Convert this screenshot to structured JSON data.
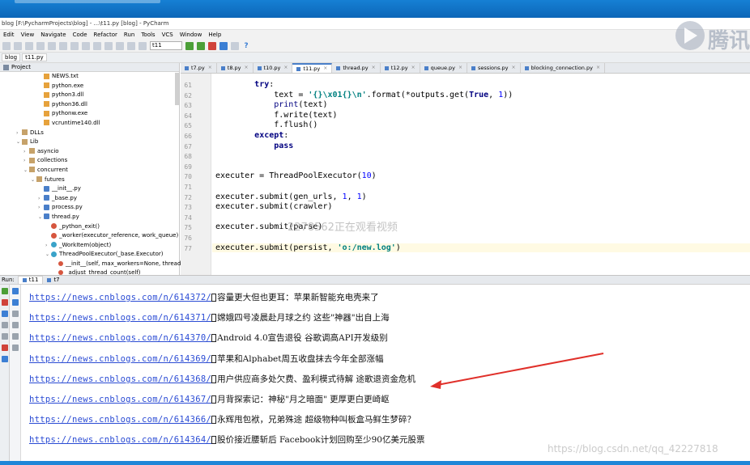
{
  "window": {
    "title": "blog [F:\\PycharmProjects\\blog] - ...\\t11.py [blog] - PyCharm"
  },
  "menu": [
    "Edit",
    "View",
    "Navigate",
    "Code",
    "Refactor",
    "Run",
    "Tools",
    "VCS",
    "Window",
    "Help"
  ],
  "toolbar": {
    "run_config": "t11",
    "help": "?"
  },
  "breadcrumb": [
    "blog",
    "t11.py"
  ],
  "logo_text": "腾讯",
  "project_panel": {
    "header": "Project",
    "tree": [
      {
        "label": "NEWS.txt",
        "icon": "file-icon",
        "depth": 5
      },
      {
        "label": "python.exe",
        "icon": "file-icon",
        "depth": 5
      },
      {
        "label": "python3.dll",
        "icon": "file-icon",
        "depth": 5
      },
      {
        "label": "python36.dll",
        "icon": "file-icon",
        "depth": 5
      },
      {
        "label": "pythonw.exe",
        "icon": "file-icon",
        "depth": 5
      },
      {
        "label": "vcruntime140.dll",
        "icon": "file-icon",
        "depth": 5
      },
      {
        "label": "DLLs",
        "icon": "folder-icon",
        "depth": 2,
        "arrow": "›"
      },
      {
        "label": "Lib",
        "icon": "folder-icon",
        "depth": 2,
        "arrow": "⌄"
      },
      {
        "label": "asyncio",
        "icon": "folder-icon",
        "depth": 3,
        "arrow": "›"
      },
      {
        "label": "collections",
        "icon": "folder-icon",
        "depth": 3,
        "arrow": "›"
      },
      {
        "label": "concurrent",
        "icon": "folder-icon",
        "depth": 3,
        "arrow": "⌄"
      },
      {
        "label": "futures",
        "icon": "folder-icon",
        "depth": 4,
        "arrow": "⌄"
      },
      {
        "label": "__init__.py",
        "icon": "python-file-icon",
        "depth": 5
      },
      {
        "label": "_base.py",
        "icon": "python-file-icon",
        "depth": 5,
        "arrow": "›"
      },
      {
        "label": "process.py",
        "icon": "python-file-icon",
        "depth": 5,
        "arrow": "›"
      },
      {
        "label": "thread.py",
        "icon": "python-file-icon",
        "depth": 5,
        "arrow": "⌄"
      },
      {
        "label": "_python_exit()",
        "icon": "function-icon",
        "depth": 6
      },
      {
        "label": "_worker(executor_reference, work_queue)",
        "icon": "function-icon",
        "depth": 6
      },
      {
        "label": "_WorkItem(object)",
        "icon": "class-icon",
        "depth": 6,
        "arrow": "›"
      },
      {
        "label": "ThreadPoolExecutor(_base.Executor)",
        "icon": "class-icon",
        "depth": 6,
        "arrow": "⌄"
      },
      {
        "label": "__init__(self, max_workers=None, thread",
        "icon": "method-icon",
        "depth": 7
      },
      {
        "label": "_adjust_thread_count(self)",
        "icon": "method-icon",
        "depth": 7
      }
    ]
  },
  "editor_tabs": [
    {
      "label": "t7.py",
      "active": false
    },
    {
      "label": "t8.py",
      "active": false
    },
    {
      "label": "t10.py",
      "active": false
    },
    {
      "label": "t11.py",
      "active": true
    },
    {
      "label": "thread.py",
      "active": false
    },
    {
      "label": "t12.py",
      "active": false
    },
    {
      "label": "queue.py",
      "active": false
    },
    {
      "label": "sessions.py",
      "active": false
    },
    {
      "label": "blocking_connection.py",
      "active": false
    }
  ],
  "code_lines": [
    {
      "n": "61",
      "html": "        <span class=\"kw\">try</span>:"
    },
    {
      "n": "62",
      "html": "            text = <span class=\"str\">'{}\\x01{}\\n'</span>.format(*outputs.get(<span class=\"kw\">True</span>, <span class=\"num\">1</span>))"
    },
    {
      "n": "63",
      "html": "            <span class=\"bi\">print</span>(text)"
    },
    {
      "n": "64",
      "html": "            f.write(text)"
    },
    {
      "n": "65",
      "html": "            f.flush()"
    },
    {
      "n": "66",
      "html": "        <span class=\"kw\">except</span>:"
    },
    {
      "n": "67",
      "html": "            <span class=\"kw\">pass</span>"
    },
    {
      "n": "68",
      "html": ""
    },
    {
      "n": "69",
      "html": ""
    },
    {
      "n": "70",
      "html": "executer = ThreadPoolExecutor(<span class=\"num\">10</span>)"
    },
    {
      "n": "71",
      "html": ""
    },
    {
      "n": "72",
      "html": "executer.submit(gen_urls, <span class=\"num\">1</span>, <span class=\"num\">1</span>)"
    },
    {
      "n": "73",
      "html": "executer.submit(crawler)"
    },
    {
      "n": "74",
      "html": ""
    },
    {
      "n": "75",
      "html": "executer.submit(parse)"
    },
    {
      "n": "76",
      "html": ""
    },
    {
      "n": "77",
      "html": "executer.submit(persist, <span class=\"str\">'o:/new.log'</span>)"
    }
  ],
  "code_watermark": "2278562正在观看视频",
  "run_panel": {
    "label": "Run:",
    "tabs": [
      {
        "label": "t11",
        "active": true
      },
      {
        "label": "t7",
        "active": false
      }
    ],
    "output": [
      {
        "url": "https://news.cnblogs.com/n/614372/",
        "text": "容量更大但也更耳：苹果新智能充电壳来了"
      },
      {
        "url": "https://news.cnblogs.com/n/614371/",
        "text": "嫦娥四号凌晨赴月球之约 这些\"神器\"出自上海"
      },
      {
        "url": "https://news.cnblogs.com/n/614370/",
        "text": "Android 4.0宣告退役 谷歌调高API开发级别"
      },
      {
        "url": "https://news.cnblogs.com/n/614369/",
        "text": "苹果和Alphabet周五收盘抹去今年全部涨幅"
      },
      {
        "url": "https://news.cnblogs.com/n/614368/",
        "text": "用户供应商多处欠费、盈利模式待解 途歌退资金危机"
      },
      {
        "url": "https://news.cnblogs.com/n/614367/",
        "text": "月背探索记：神秘\"月之暗面\" 更厚更白更崎岖"
      },
      {
        "url": "https://news.cnblogs.com/n/614366/",
        "text": "永辉甩包袱，兄弟殊途 超级物种叫板盒马鲜生梦碎？"
      },
      {
        "url": "https://news.cnblogs.com/n/614364/",
        "text": "股价接近腰斩后 Facebook计划回购至少90亿美元股票"
      }
    ]
  },
  "csdn_watermark": "https://blog.csdn.net/qq_42227818"
}
